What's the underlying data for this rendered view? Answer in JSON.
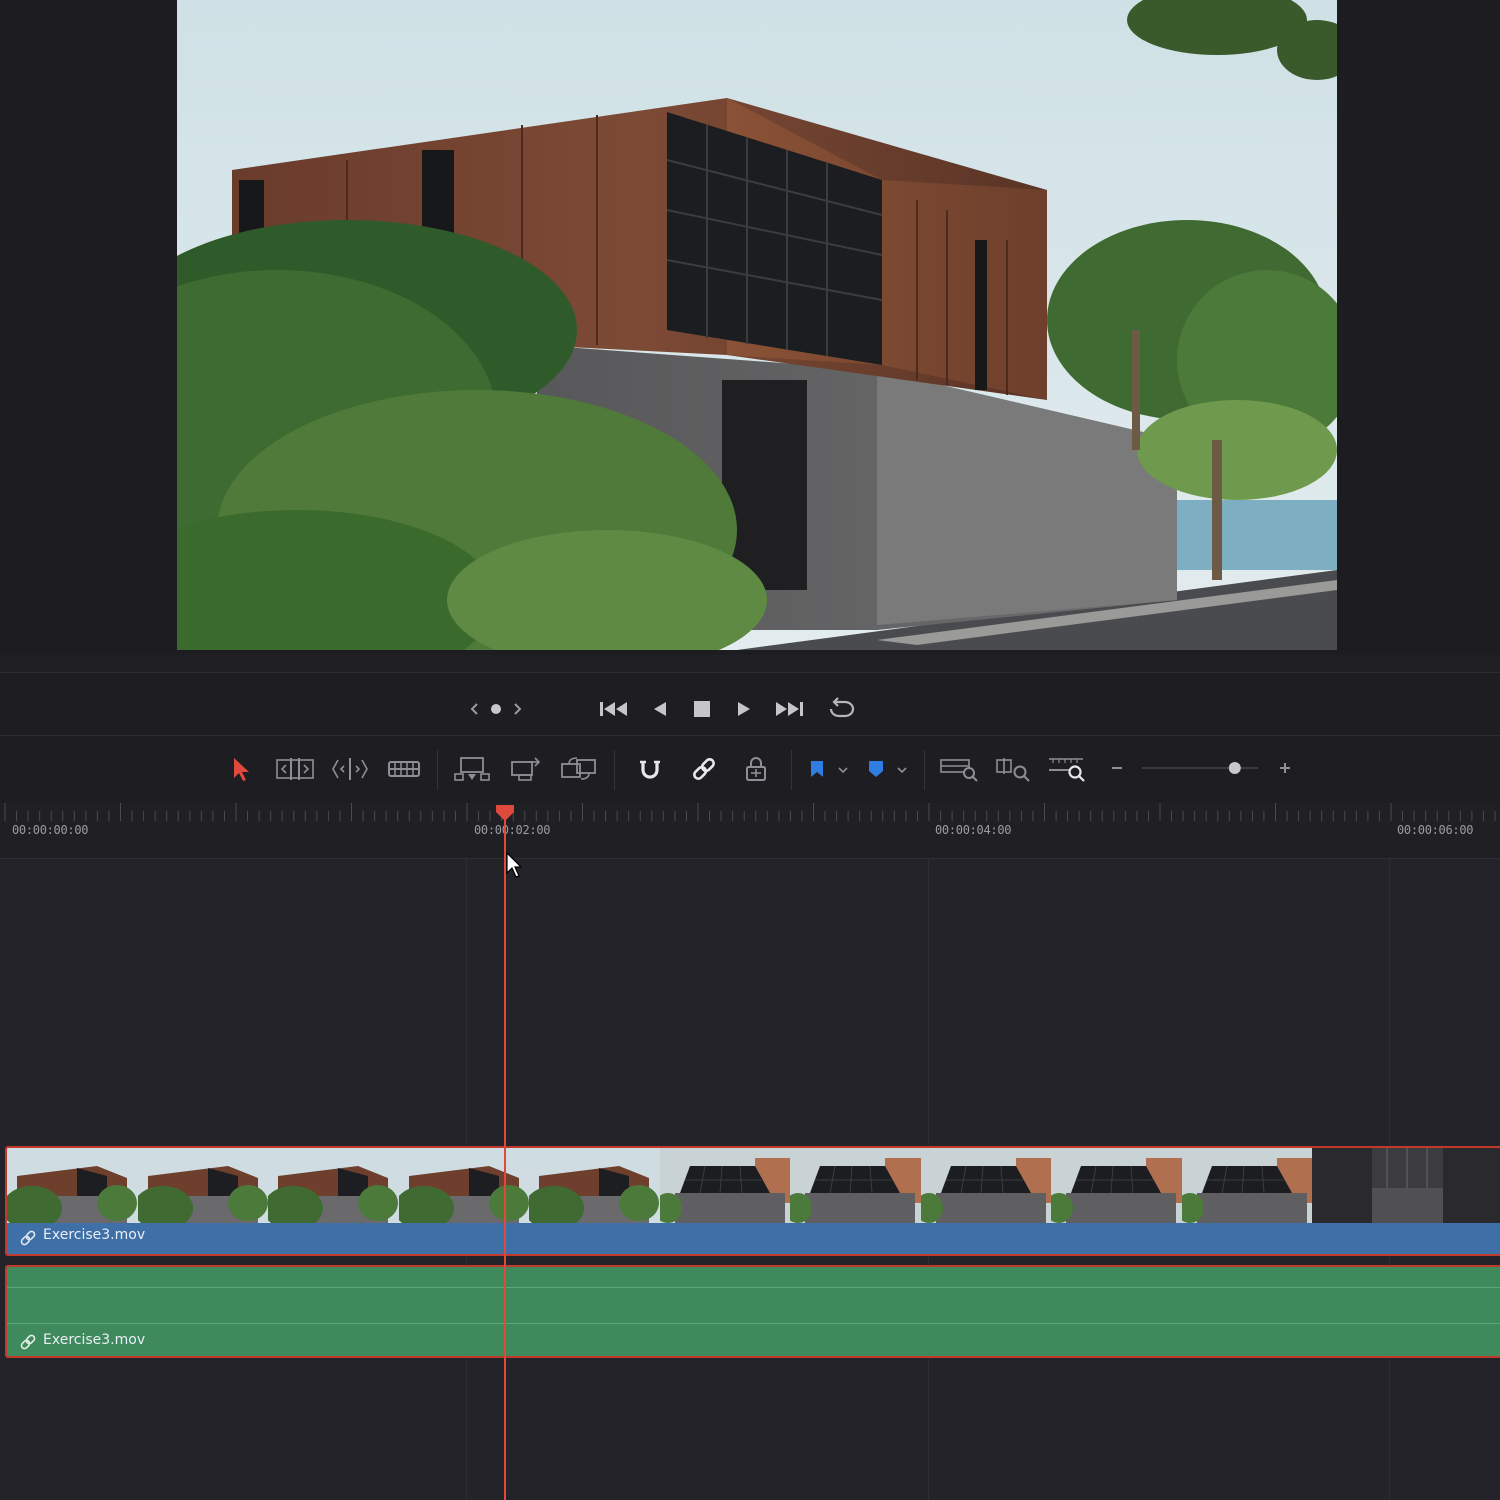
{
  "viewer": {
    "frame_description_icon": "rendered-architecture-frame"
  },
  "transport": {
    "icons": [
      "prev-clip-icon",
      "clip-dot-icon",
      "next-clip-icon",
      "go-to-start-icon",
      "play-reverse-icon",
      "stop-icon",
      "play-icon",
      "go-to-end-icon",
      "loop-icon"
    ]
  },
  "toolbar": {
    "icons": [
      "selection-mode-icon",
      "trim-edit-mode-icon",
      "dynamic-trim-mode-icon",
      "blade-edit-mode-icon",
      "insert-clip-icon",
      "overwrite-clip-icon",
      "replace-clip-icon",
      "snapping-icon",
      "linked-selection-icon",
      "position-lock-icon",
      "flag-icon",
      "marker-icon",
      "full-extent-zoom-icon",
      "detail-zoom-icon",
      "custom-zoom-icon",
      "zoom-out-icon",
      "zoom-in-icon"
    ],
    "zoom_level": 0.8,
    "accent_color": "#2f7de1",
    "selection_color": "#e04a3c"
  },
  "timeline": {
    "timecodes": [
      "00:00:00:00",
      "00:00:02:00",
      "00:00:04:00",
      "00:00:06:00"
    ],
    "playhead_timecode": "00:00:02:02",
    "playhead_color": "#e04a3c"
  },
  "tracks": {
    "video": {
      "clip_name": "Exercise3.mov",
      "color": "#3e6fa6"
    },
    "audio": {
      "clip_name": "Exercise3.mov",
      "color": "#3f8a5c"
    }
  }
}
